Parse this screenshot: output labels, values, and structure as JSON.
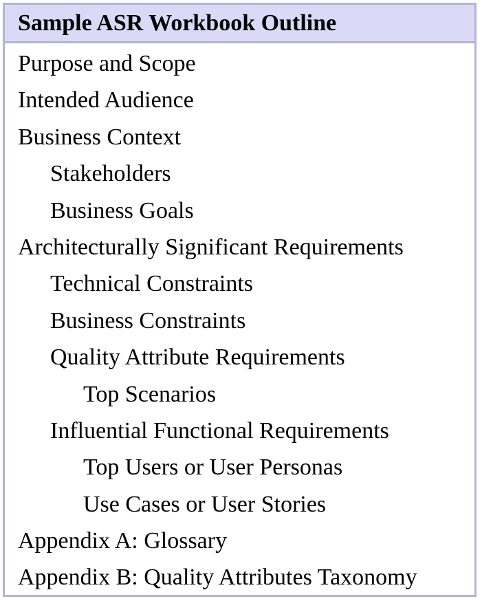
{
  "outline": {
    "title": "Sample ASR Workbook Outline",
    "items": [
      {
        "label": "Purpose and Scope",
        "level": 0
      },
      {
        "label": "Intended Audience",
        "level": 0
      },
      {
        "label": "Business Context",
        "level": 0
      },
      {
        "label": "Stakeholders",
        "level": 1
      },
      {
        "label": "Business Goals",
        "level": 1
      },
      {
        "label": "Architecturally Significant Requirements",
        "level": 0
      },
      {
        "label": "Technical Constraints",
        "level": 1
      },
      {
        "label": "Business Constraints",
        "level": 1
      },
      {
        "label": "Quality Attribute Requirements",
        "level": 1
      },
      {
        "label": "Top Scenarios",
        "level": 2
      },
      {
        "label": "Influential Functional Requirements",
        "level": 1
      },
      {
        "label": "Top Users or User Personas",
        "level": 2
      },
      {
        "label": "Use Cases or User Stories",
        "level": 2
      },
      {
        "label": "Appendix A: Glossary",
        "level": 0
      },
      {
        "label": "Appendix B: Quality Attributes Taxonomy",
        "level": 0
      }
    ]
  },
  "colors": {
    "header_background": "#dadaf7",
    "border": "#b2b2dc",
    "text": "#000000"
  }
}
